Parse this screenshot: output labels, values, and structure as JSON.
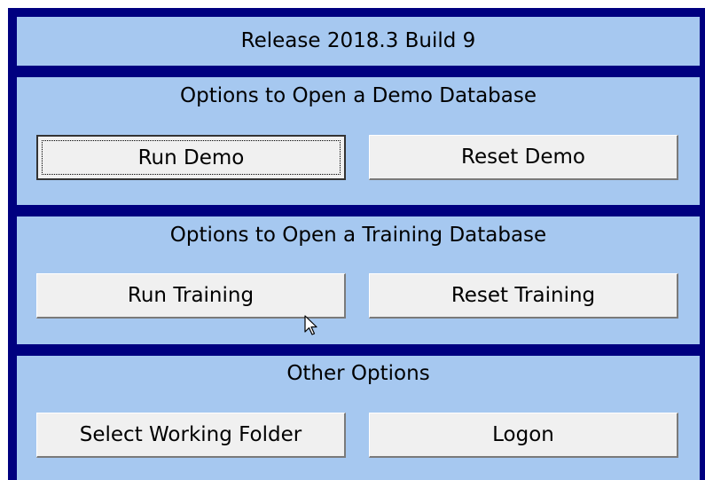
{
  "release": {
    "text": "Release 2018.3 Build 9"
  },
  "demo": {
    "title": "Options to Open a Demo Database",
    "run_label": "Run Demo",
    "reset_label": "Reset Demo"
  },
  "training": {
    "title": "Options to Open a Training Database",
    "run_label": "Run Training",
    "reset_label": "Reset Training"
  },
  "other": {
    "title": "Other Options",
    "folder_label": "Select Working Folder",
    "logon_label": "Logon"
  },
  "colors": {
    "frame": "#000080",
    "panel": "#a6c8f0",
    "button": "#f0f0f0"
  },
  "icons": {
    "cursor": "mouse-pointer-icon"
  }
}
